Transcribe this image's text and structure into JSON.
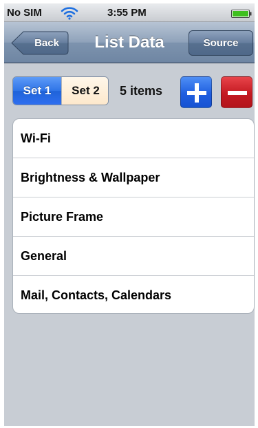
{
  "status_bar": {
    "carrier": "No SIM",
    "time": "3:55 PM",
    "wifi_icon": "wifi-icon",
    "battery_icon": "battery-icon",
    "battery_color": "#3fbf1f"
  },
  "nav": {
    "back_label": "Back",
    "title": "List Data",
    "source_label": "Source"
  },
  "controls": {
    "segments": [
      {
        "label": "Set 1",
        "selected": true
      },
      {
        "label": "Set 2",
        "selected": false
      }
    ],
    "items_count": "5 items",
    "add_icon": "plus-icon",
    "remove_icon": "minus-icon",
    "add_color": "#1f5ee0",
    "remove_color": "#c41a22"
  },
  "list": {
    "items": [
      {
        "label": "Wi-Fi"
      },
      {
        "label": "Brightness & Wallpaper"
      },
      {
        "label": "Picture Frame"
      },
      {
        "label": "General"
      },
      {
        "label": "Mail, Contacts, Calendars"
      }
    ]
  }
}
